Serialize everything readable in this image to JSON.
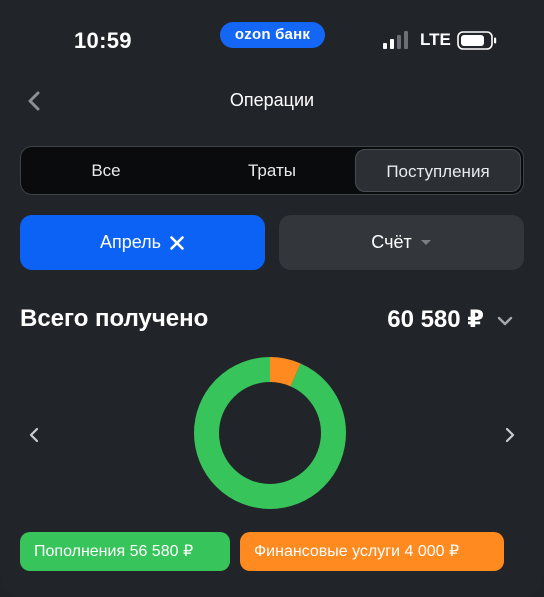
{
  "status_bar": {
    "time": "10:59",
    "brand": "ozon банк",
    "network": "LTE"
  },
  "header": {
    "title": "Операции",
    "back_icon": "chevron-left-icon"
  },
  "tabs": [
    {
      "label": "Все",
      "active": false
    },
    {
      "label": "Траты",
      "active": false
    },
    {
      "label": "Поступления",
      "active": true
    }
  ],
  "filters": {
    "month": {
      "label": "Апрель",
      "clear_icon": "close-icon"
    },
    "account": {
      "label": "Счёт",
      "icon": "caret-down-icon"
    }
  },
  "summary": {
    "label": "Всего получено",
    "amount": "60 580 ₽",
    "toggle_icon": "chevron-down-icon"
  },
  "chart_data": {
    "type": "pie",
    "style": "donut",
    "categories": [
      "Пополнения",
      "Финансовые услуги"
    ],
    "values": [
      56580,
      4000
    ],
    "colors": [
      "#37c45a",
      "#ff8a1f"
    ]
  },
  "legend": [
    {
      "text": "Пополнения 56 580 ₽",
      "color": "#37c45a"
    },
    {
      "text": "Финансовые услуги 4 000 ₽",
      "color": "#ff8a1f"
    }
  ],
  "colors": {
    "background": "#212429",
    "accent": "#0c62f5",
    "brand": "#1466f5",
    "income_green": "#37c45a",
    "services_orange": "#ff8a1f"
  }
}
